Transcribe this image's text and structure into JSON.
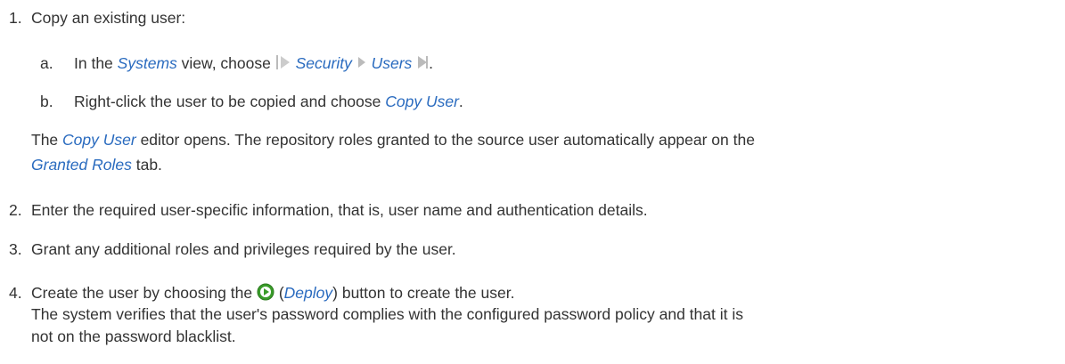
{
  "steps": [
    {
      "num": "1.",
      "text": "Copy an existing user:"
    },
    {
      "num": "2.",
      "text": "Enter the required user-specific information, that is, user name and authentication details."
    },
    {
      "num": "3.",
      "text": "Grant any additional roles and privileges required by the user."
    },
    {
      "num": "4.",
      "text_a": "Create the user by choosing the",
      "deploy": "Deploy",
      "text_b": "button to create the user.",
      "note": [
        "The system verifies that the user's password complies with the configured password policy and that it is",
        "not on the password blacklist."
      ]
    }
  ],
  "substeps": [
    {
      "letter": "a.",
      "text_a": "In the",
      "systems": "Systems",
      "text_b": "view, choose",
      "security": "Security",
      "users": "Users",
      "end": "."
    },
    {
      "letter": "b.",
      "text_a": "Right-click the user to be copied and choose",
      "copy_user": "Copy User",
      "end": "."
    }
  ],
  "editor_note": {
    "a": "The",
    "copy_user": "Copy User",
    "b": "editor opens. The repository roles granted to the source user automatically appear on the",
    "granted_roles": "Granted Roles",
    "c": "tab."
  },
  "icons": {
    "arrow": "navigation-arrow-icon",
    "deploy": "deploy-icon"
  },
  "colors": {
    "link": "#2a6bbf",
    "text": "#333333",
    "deploy_green": "#3a9c2a"
  }
}
